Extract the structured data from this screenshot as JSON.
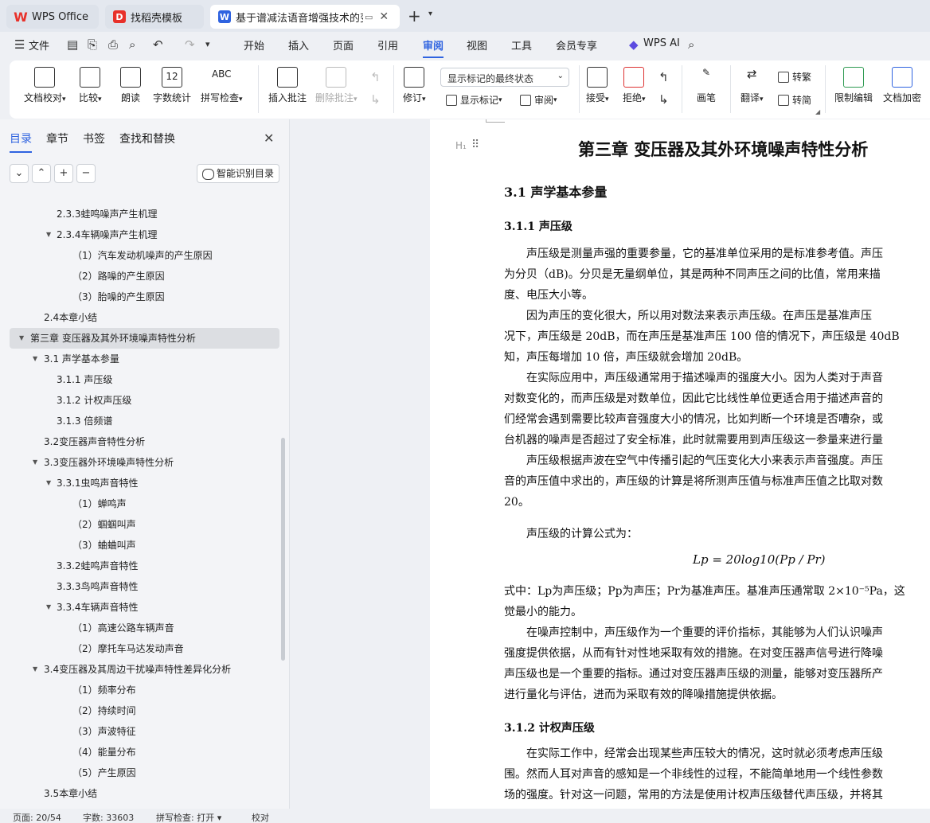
{
  "tabs": [
    {
      "label": "WPS Office",
      "icon": "wps-logo-icon"
    },
    {
      "label": "找稻壳模板",
      "icon": "docer-icon"
    },
    {
      "label": "基于谱减法语音增强技术的变压",
      "icon": "word-doc-icon"
    }
  ],
  "menu": {
    "file": "文件",
    "items": [
      "开始",
      "插入",
      "页面",
      "引用",
      "审阅",
      "视图",
      "工具",
      "会员专享"
    ],
    "active": "审阅",
    "ai": "WPS AI"
  },
  "ribbon": {
    "proofread": "文档校对",
    "compare": "比较",
    "read": "朗读",
    "wordcount": "字数统计",
    "spellcheck": "拼写检查",
    "spell_icon_text": "ABC",
    "wordcount_icon_text": "12",
    "insert_comment": "插入批注",
    "delete_comment": "删除批注",
    "track": "修订",
    "markup_select": "显示标记的最终状态",
    "show_markup": "显示标记",
    "review": "审阅",
    "accept": "接受",
    "reject": "拒绝",
    "pen": "画笔",
    "translate": "翻译",
    "to_traditional": "转繁",
    "to_simplified": "转简",
    "restrict": "限制编辑",
    "protect": "文档加密"
  },
  "nav": {
    "tabs": [
      "目录",
      "章节",
      "书签",
      "查找和替换"
    ],
    "active_tab": "目录",
    "smart_toc": "智能识别目录",
    "toc": [
      {
        "text": "2.3.3蛙鸣噪声产生机理",
        "level": 3,
        "tri": false
      },
      {
        "text": "2.3.4车辆噪声产生机理",
        "level": 3,
        "tri": true
      },
      {
        "text": "（1）汽车发动机噪声的产生原因",
        "level": 4,
        "tri": false
      },
      {
        "text": "（2）路噪的产生原因",
        "level": 4,
        "tri": false
      },
      {
        "text": "（3）胎噪的产生原因",
        "level": 4,
        "tri": false
      },
      {
        "text": "2.4本章小结",
        "level": 2,
        "tri": false
      },
      {
        "text": "第三章  变压器及其外环境噪声特性分析",
        "level": 1,
        "tri": true,
        "selected": true
      },
      {
        "text": "3.1  声学基本参量",
        "level": 2,
        "tri": true
      },
      {
        "text": "3.1.1  声压级",
        "level": 3,
        "tri": false
      },
      {
        "text": "3.1.2  计权声压级",
        "level": 3,
        "tri": false
      },
      {
        "text": "3.1.3  倍频谱",
        "level": 3,
        "tri": false
      },
      {
        "text": "3.2变压器声音特性分析",
        "level": 2,
        "tri": false
      },
      {
        "text": "3.3变压器外环境噪声特性分析",
        "level": 2,
        "tri": true
      },
      {
        "text": "3.3.1虫鸣声音特性",
        "level": 3,
        "tri": true
      },
      {
        "text": "（1）蝉鸣声",
        "level": 4,
        "tri": false
      },
      {
        "text": "（2）蝈蝈叫声",
        "level": 4,
        "tri": false
      },
      {
        "text": "（3）蛐蛐叫声",
        "level": 4,
        "tri": false
      },
      {
        "text": "3.3.2蛙鸣声音特性",
        "level": 3,
        "tri": false
      },
      {
        "text": "3.3.3鸟鸣声音特性",
        "level": 3,
        "tri": false
      },
      {
        "text": "3.3.4车辆声音特性",
        "level": 3,
        "tri": true
      },
      {
        "text": "（1）高速公路车辆声音",
        "level": 4,
        "tri": false
      },
      {
        "text": "（2）摩托车马达发动声音",
        "level": 4,
        "tri": false
      },
      {
        "text": "3.4变压器及其周边干扰噪声特性差异化分析",
        "level": 2,
        "tri": true
      },
      {
        "text": "（1）频率分布",
        "level": 4,
        "tri": false
      },
      {
        "text": "（2）持续时间",
        "level": 4,
        "tri": false
      },
      {
        "text": "（3）声波特征",
        "level": 4,
        "tri": false
      },
      {
        "text": "（4）能量分布",
        "level": 4,
        "tri": false
      },
      {
        "text": "（5）产生原因",
        "level": 4,
        "tri": false
      },
      {
        "text": "3.5本章小结",
        "level": 2,
        "tri": false
      }
    ]
  },
  "doc": {
    "h_marker": "H₁",
    "chapter_title": "第三章  变压器及其外环境噪声特性分析",
    "sec_3_1": "3.1   声学基本参量",
    "sec_3_1_1": "3.1.1   声压级",
    "p1": [
      "　　声压级是测量声强的重要参量，它的基准单位采用的是标准参考值。声压",
      "为分贝（dB)。分贝是无量纲单位，其是两种不同声压之间的比值，常用来描",
      "度、电压大小等。"
    ],
    "p2": [
      "　　因为声压的变化很大，所以用对数法来表示声压级。在声压是基准声压",
      "况下，声压级是 20dB，而在声压是基准声压 100 倍的情况下，声压级是 40dB",
      "知，声压每增加 10 倍，声压级就会增加 20dB。"
    ],
    "p3": [
      "　　在实际应用中，声压级通常用于描述噪声的强度大小。因为人类对于声音",
      "对数变化的，而声压级是对数单位，因此它比线性单位更适合用于描述声音的",
      "们经常会遇到需要比较声音强度大小的情况，比如判断一个环境是否嘈杂，或",
      "台机器的噪声是否超过了安全标准，此时就需要用到声压级这一参量来进行量"
    ],
    "p4": [
      "　　声压级根据声波在空气中传播引起的气压变化大小来表示声音强度。声压",
      "音的声压值中求出的，声压级的计算是将所测声压值与标准声压值之比取对数",
      "20。"
    ],
    "p5": "　　声压级的计算公式为：",
    "formula": "Lp = 20log10(Pp / Pr)",
    "p6": [
      "式中：Lp为声压级；Pp为声压；Pr为基准声压。基准声压通常取 2×10⁻⁵Pa，这",
      "觉最小的能力。"
    ],
    "p7": [
      "　　在噪声控制中，声压级作为一个重要的评价指标，其能够为人们认识噪声",
      "强度提供依据，从而有针对性地采取有效的措施。在对变压器声信号进行降噪",
      "声压级也是一个重要的指标。通过对变压器声压级的测量，能够对变压器所产",
      "进行量化与评估，进而为采取有效的降噪措施提供依据。"
    ],
    "sec_3_1_2": "3.1.2   计权声压级",
    "p8": [
      "　　在实际工作中，经常会出现某些声压较大的情况，这时就必须考虑声压级",
      "围。然而人耳对声音的感知是一个非线性的过程，不能简单地用一个线性参数",
      "场的强度。针对这一问题，常用的方法是使用计权声压级替代声压级，并将其"
    ]
  },
  "status": {
    "page": "页面: 20/54",
    "words": "字数: 33603",
    "spell": "拼写检查: 打开",
    "proof": "校对"
  }
}
